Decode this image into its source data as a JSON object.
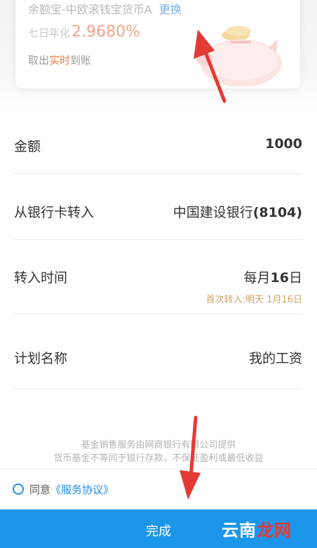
{
  "fund": {
    "name": "余额宝-中欧滚钱宝货币A",
    "change_label": "更换",
    "yield_label": "七日年化",
    "yield_value": "2.9680%",
    "redeem_prefix": "取出",
    "redeem_highlight": "实时",
    "redeem_suffix": "到账"
  },
  "form": {
    "amount": {
      "label": "金额",
      "value": "1000"
    },
    "source": {
      "label": "从银行卡转入",
      "bank": "中国建设银行",
      "card": "(8104)"
    },
    "time": {
      "label": "转入时间",
      "prefix": "每月",
      "day": "16",
      "suffix": "日",
      "hint": "首次转入:明天 1月16日"
    },
    "plan": {
      "label": "计划名称",
      "value": "我的工资"
    }
  },
  "disclaimer": {
    "line1": "基金销售服务由网商银行有限公司提供",
    "line2": "货币基金不等同于银行存款，不保证盈利或最低收益"
  },
  "agreement": {
    "prefix": "同意",
    "link": "《服务协议》"
  },
  "done_button": {
    "label": "完成"
  },
  "watermark": {
    "part1": "云南",
    "part2": "龙网"
  },
  "colors": {
    "accent_blue": "#1c96ea",
    "yield_orange": "#f2a488",
    "highlight_orange": "#f07a4a",
    "hint_gold": "#c9a66b",
    "annotation_red": "#e53935"
  },
  "icons": {
    "piggy": "piggy-bank-illustration",
    "radio": "radio-unchecked-icon"
  }
}
